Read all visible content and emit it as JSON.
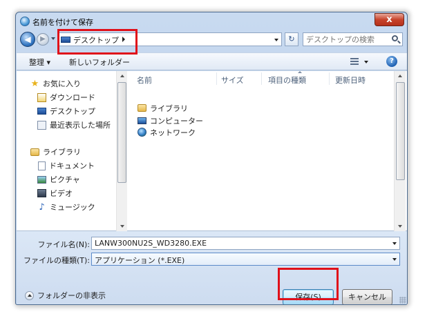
{
  "window": {
    "title": "名前を付けて保存",
    "close_label": "x"
  },
  "navbar": {
    "back_glyph": "◀",
    "forward_glyph": "▶",
    "address_text": "デスクトップ",
    "refresh_glyph": "↻",
    "search_placeholder": "デスクトップの検索"
  },
  "toolbar": {
    "organize_label": "整理 ▾",
    "new_folder_label": "新しいフォルダー",
    "help_label": "?"
  },
  "sidebar": {
    "favorites": {
      "header": "お気に入り",
      "items": [
        {
          "label": "ダウンロード"
        },
        {
          "label": "デスクトップ"
        },
        {
          "label": "最近表示した場所"
        }
      ]
    },
    "libraries": {
      "header": "ライブラリ",
      "items": [
        {
          "label": "ドキュメント"
        },
        {
          "label": "ピクチャ"
        },
        {
          "label": "ビデオ"
        },
        {
          "label": "ミュージック"
        }
      ]
    }
  },
  "file_list": {
    "columns": [
      "名前",
      "サイズ",
      "項目の種類",
      "更新日時"
    ],
    "items": [
      {
        "name": "ライブラリ",
        "icon": "library-icon"
      },
      {
        "name": "コンピューター",
        "icon": "computer-icon"
      },
      {
        "name": "ネットワーク",
        "icon": "network-icon"
      }
    ]
  },
  "form": {
    "filename_label": "ファイル名(N):",
    "filename_value": "LANW300NU2S_WD3280.EXE",
    "filetype_label": "ファイルの種類(T):",
    "filetype_value": "アプリケーション (*.EXE)"
  },
  "footer": {
    "hide_folders_label": "フォルダーの非表示",
    "save_label": "保存(S)",
    "cancel_label": "キャンセル"
  },
  "colors": {
    "highlight": "#e0101a",
    "window_frame": "#b8cde8",
    "close_button": "#c7432b"
  }
}
